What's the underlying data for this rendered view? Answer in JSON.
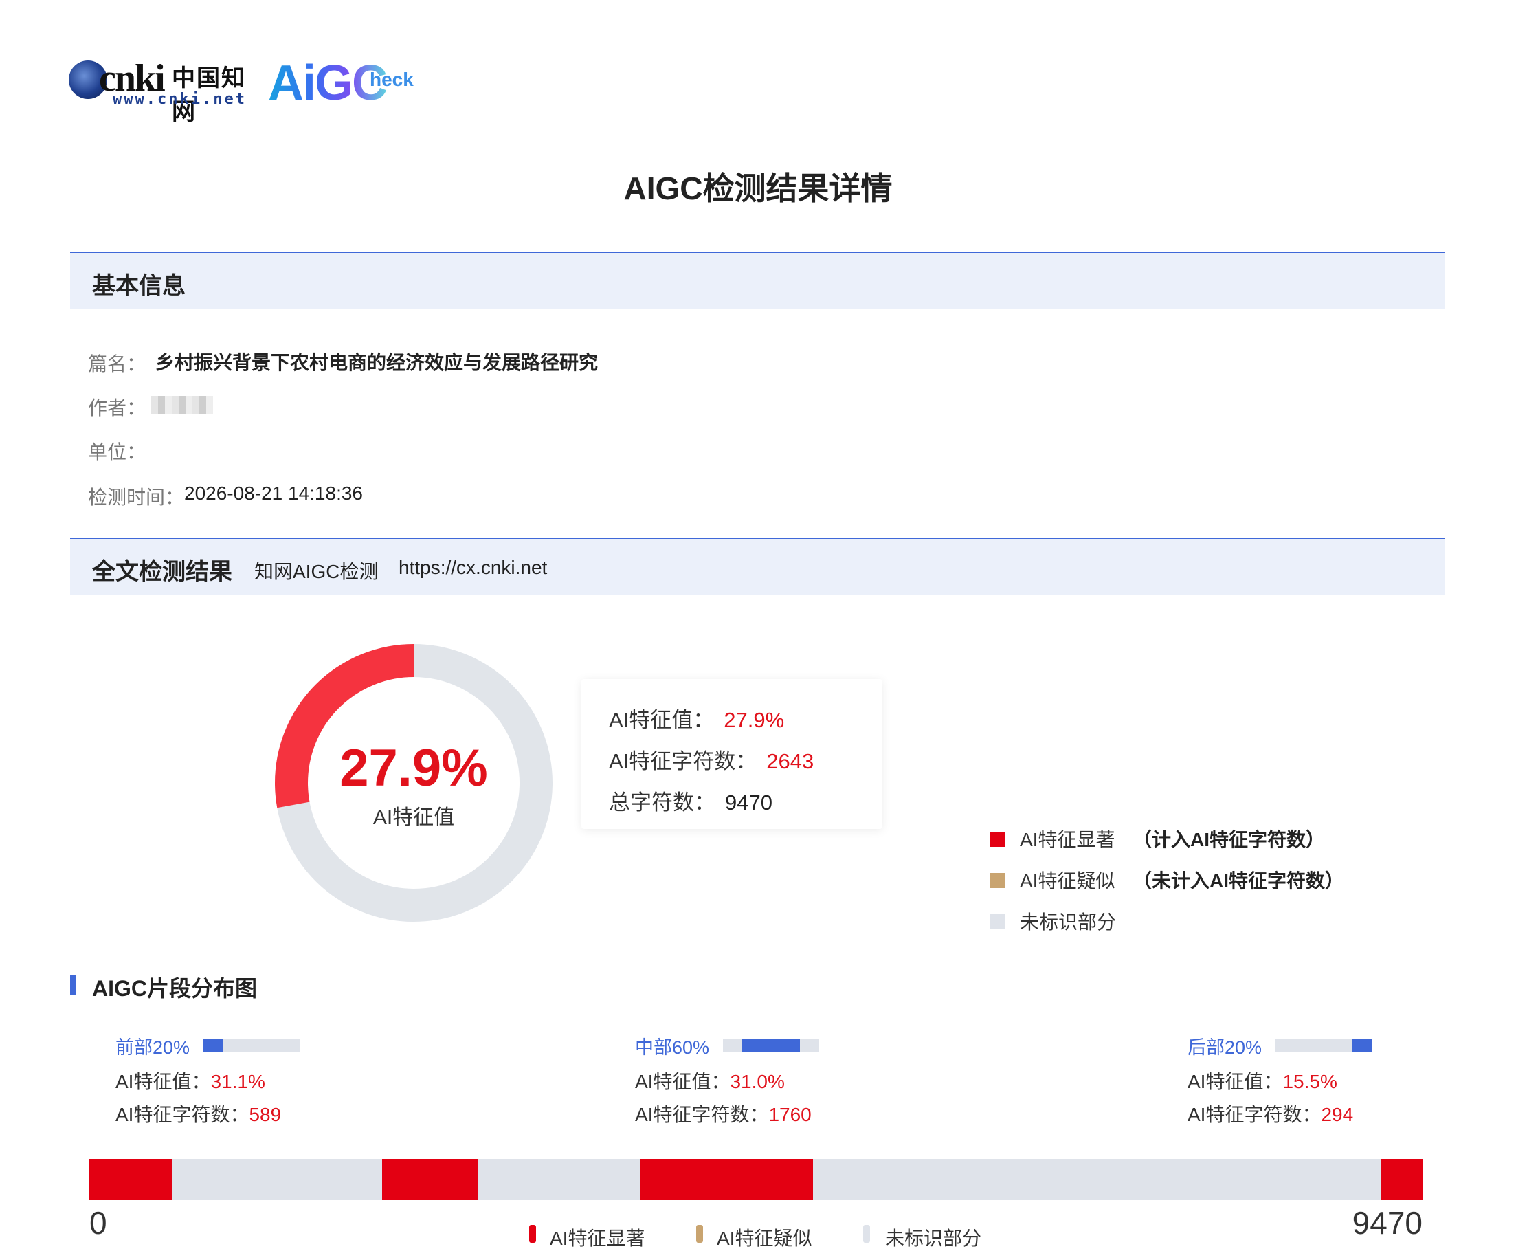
{
  "logo": {
    "cnki_word": "cnki",
    "cnki_cn": "中国知网",
    "cnki_url": "www.cnki.net",
    "aigc_word": "AiGC",
    "aigc_check": "heck"
  },
  "page_title": "AIGC检测结果详情",
  "basic_info": {
    "section_title": "基本信息",
    "title_label": "篇名：",
    "title_value": "乡村振兴背景下农村电商的经济效应与发展路径研究",
    "author_label": "作者：",
    "unit_label": "单位：",
    "time_label": "检测时间：",
    "time_value": "2026-08-21 14:18:36"
  },
  "result_section": {
    "section_title": "全文检测结果",
    "service_name": "知网AIGC检测",
    "service_url": "https://cx.cnki.net"
  },
  "donut": {
    "ai_fraction": 0.279,
    "percent_text": "27.9%",
    "label": "AI特征值",
    "colors": {
      "ai": "#f5333f",
      "rest": "#e1e5ea"
    }
  },
  "stats": {
    "ai_value_label": "AI特征值：",
    "ai_value": "27.9%",
    "ai_chars_label": "AI特征字符数：",
    "ai_chars": "2643",
    "total_chars_label": "总字符数：",
    "total_chars": "9470"
  },
  "legend": {
    "items": [
      {
        "label": "AI特征显著",
        "note": "（计入AI特征字符数）",
        "color": "#e30012"
      },
      {
        "label": "AI特征疑似",
        "note": "（未计入AI特征字符数）",
        "color": "#c9a470"
      },
      {
        "label": "未标识部分",
        "note": "",
        "color": "#dfe3ea"
      }
    ]
  },
  "distribution": {
    "title": "AIGC片段分布图",
    "parts": [
      {
        "name": "前部20%",
        "range_start": 0.0,
        "range_end": 0.2,
        "ai_value_label": "AI特征值：",
        "ai_value": "31.1%",
        "ai_chars_label": "AI特征字符数：",
        "ai_chars": "589"
      },
      {
        "name": "中部60%",
        "range_start": 0.2,
        "range_end": 0.8,
        "ai_value_label": "AI特征值：",
        "ai_value": "31.0%",
        "ai_chars_label": "AI特征字符数：",
        "ai_chars": "1760"
      },
      {
        "name": "后部20%",
        "range_start": 0.8,
        "range_end": 1.0,
        "ai_value_label": "AI特征值：",
        "ai_value": "15.5%",
        "ai_chars_label": "AI特征字符数：",
        "ai_chars": "294"
      }
    ],
    "segments": [
      {
        "start": 0,
        "end": 590
      },
      {
        "start": 2080,
        "end": 2760
      },
      {
        "start": 3910,
        "end": 5140
      },
      {
        "start": 9170,
        "end": 9470
      }
    ],
    "axis_start": "0",
    "axis_end": "9470",
    "bottom_legend": [
      {
        "label": "AI特征显著",
        "color": "#e30012"
      },
      {
        "label": "AI特征疑似",
        "color": "#c9a470"
      },
      {
        "label": "未标识部分",
        "color": "#dfe3ea"
      }
    ]
  }
}
